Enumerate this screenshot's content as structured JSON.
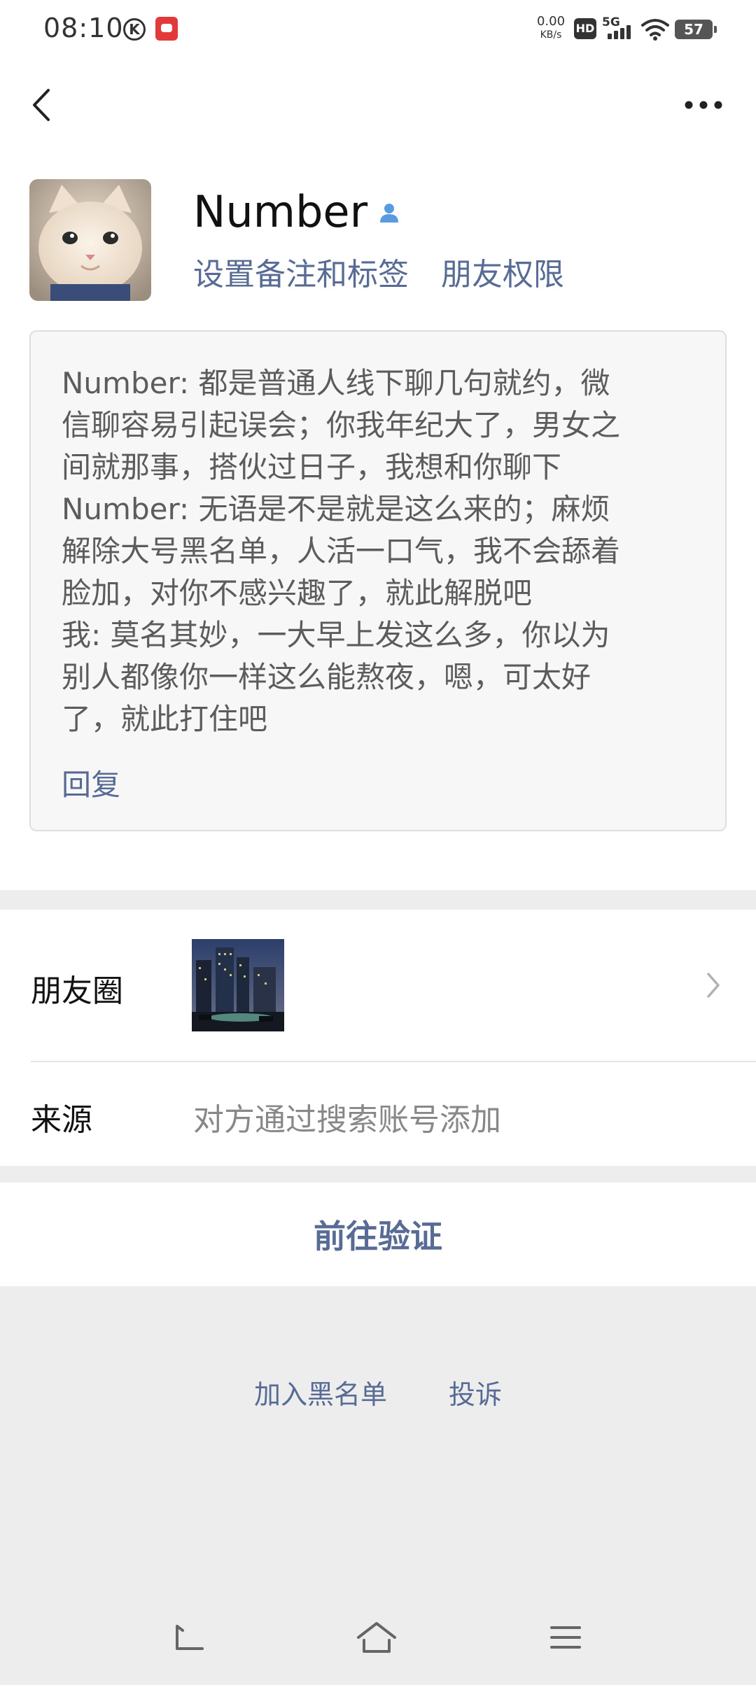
{
  "status_bar": {
    "time": "08:10",
    "k_badge": "K",
    "net_speed_value": "0.00",
    "net_speed_unit": "KB/s",
    "hd_label": "HD",
    "signal_label": "5G",
    "battery_level": "57"
  },
  "nav": {
    "back_icon": "chevron-left-icon",
    "more_icon": "more-dots-icon"
  },
  "profile": {
    "name": "Number",
    "name_badge_icon": "user-icon",
    "set_remark_label": "设置备注和标签",
    "friend_permission_label": "朋友权限"
  },
  "message": {
    "text": "Number: 都是普通人线下聊几句就约，微\n信聊容易引起误会；你我年纪大了，男女之\n间就那事，搭伙过日子，我想和你聊下\nNumber: 无语是不是就是这么来的；麻烦\n解除大号黑名单，人活一口气，我不会舔着\n脸加，对你不感兴趣了，就此解脱吧\n我: 莫名其妙，一大早上发这么多，你以为\n别人都像你一样这么能熬夜，嗯，可太好\n了，就此打住吧",
    "reply_label": "回复"
  },
  "rows": {
    "moments_label": "朋友圈",
    "source_label": "来源",
    "source_value": "对方通过搜索账号添加"
  },
  "verify": {
    "label": "前往验证"
  },
  "bottom": {
    "blacklist_label": "加入黑名单",
    "report_label": "投诉"
  },
  "colors": {
    "link_blue": "#576b95",
    "background": "#ededed",
    "card": "#ffffff"
  }
}
